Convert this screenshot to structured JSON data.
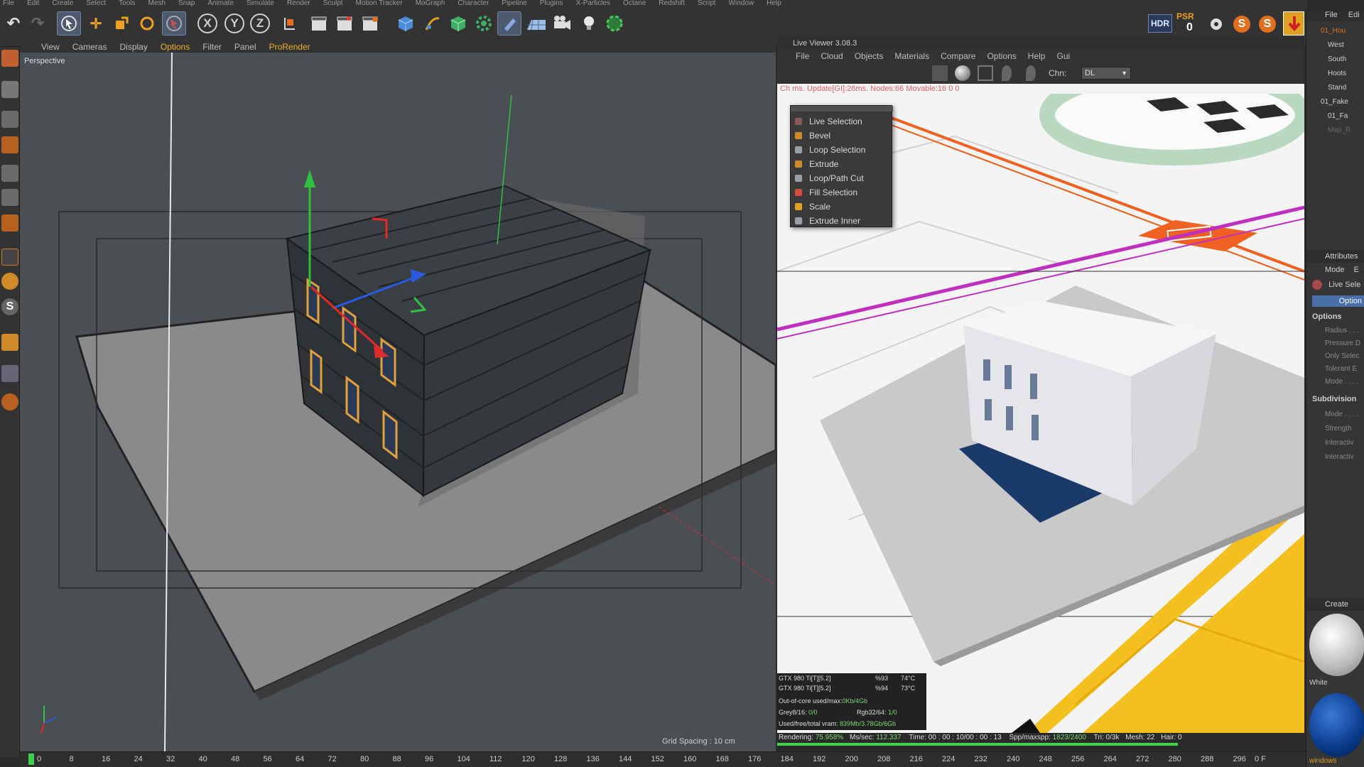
{
  "menubar": [
    "File",
    "Edit",
    "Create",
    "Select",
    "Tools",
    "Mesh",
    "Snap",
    "Animate",
    "Simulate",
    "Render",
    "Sculpt",
    "Motion Tracker",
    "MoGraph",
    "Character",
    "Pipeline",
    "Plugins",
    "X-Particles",
    "Octane",
    "Redshift",
    "Script",
    "Window",
    "Help"
  ],
  "toolbar": {
    "axis_x": "X",
    "axis_y": "Y",
    "axis_z": "Z",
    "hdr": "HDR",
    "psr_label": "PSR",
    "psr_value": "0"
  },
  "viewport": {
    "menu": [
      "View",
      "Cameras",
      "Display",
      "Options",
      "Filter",
      "Panel",
      "ProRender"
    ],
    "label": "Perspective",
    "grid_spacing": "Grid Spacing : 10 cm",
    "colors": {
      "bg": "#4b4e52",
      "ground": "#8a8a8a",
      "building": "#2f3236"
    }
  },
  "live_viewer": {
    "title": "Live Viewer 3.08.3",
    "menu": [
      "File",
      "Cloud",
      "Objects",
      "Materials",
      "Compare",
      "Options",
      "Help",
      "Gui"
    ],
    "chn_label": "Chn:",
    "chn_value": "DL",
    "status": "Ch                    ms. Update[GI]:26ms. Nodes:66 Movable:16  0 0",
    "footer": {
      "rendering_label": "Rendering:",
      "rendering_value": "75.958%",
      "ms_label": "Ms/sec:",
      "ms_value": "112.337",
      "time": "Time: 00 : 00 : 10/00 : 00 : 13",
      "spp_label": "Spp/maxspp:",
      "spp_value": "1823/2400",
      "tri": "Tri: 0/3k",
      "mesh": "Mesh: 22",
      "hair": "Hair: 0",
      "progress": 75.958
    }
  },
  "context_menu": {
    "items": [
      {
        "label": "Live Selection",
        "icon": "live-selection-icon",
        "color": "#8a5a5a"
      },
      {
        "label": "Bevel",
        "icon": "bevel-icon",
        "color": "#d08a2a"
      },
      {
        "label": "Loop Selection",
        "icon": "loop-selection-icon",
        "color": "#9aa0a8"
      },
      {
        "label": "Extrude",
        "icon": "extrude-icon",
        "color": "#d08a2a"
      },
      {
        "label": "Loop/Path Cut",
        "icon": "loop-path-cut-icon",
        "color": "#9aa0a8"
      },
      {
        "label": "Fill Selection",
        "icon": "fill-selection-icon",
        "color": "#d84a3a"
      },
      {
        "label": "Scale",
        "icon": "scale-icon",
        "color": "#e0a020"
      },
      {
        "label": "Extrude Inner",
        "icon": "extrude-inner-icon",
        "color": "#9aa0a8"
      }
    ]
  },
  "gpu": {
    "rows": [
      {
        "name": "GTX 980 Ti[T][5.2]",
        "pct": "%93",
        "temp": "74°C"
      },
      {
        "name": "GTX 980 Ti[T][5.2]",
        "pct": "%94",
        "temp": "73°C"
      }
    ],
    "outofcore_label": "Out-of-core used/max:",
    "outofcore_value": "0Kb/4Gb",
    "grey_label": "Grey8/16:",
    "grey_value": "0/0",
    "rgb_label": "Rgb32/64:",
    "rgb_value": "1/0",
    "vram_label": "Used/free/total vram:",
    "vram_value": "839Mb/3.78Gb/6Gb"
  },
  "timeline": {
    "ticks": [
      "0",
      "8",
      "16",
      "24",
      "32",
      "40",
      "48",
      "56",
      "64",
      "72",
      "80",
      "88",
      "96",
      "104",
      "112",
      "120",
      "128",
      "136",
      "144",
      "152",
      "160",
      "168",
      "176",
      "184",
      "192",
      "200",
      "208",
      "216",
      "224",
      "232",
      "240",
      "248",
      "256",
      "264",
      "272",
      "280",
      "288",
      "296"
    ],
    "frame": "0 F"
  },
  "right_panel": {
    "file_menu": "File",
    "edit_menu": "Edi",
    "tree": [
      "01_Hou",
      "West",
      "South",
      "Hoots",
      "Stand",
      "01_Fake",
      "01_Fa",
      "Map_R"
    ],
    "attributes": "Attributes",
    "mode": "Mode",
    "mode_edit": "E",
    "live_sel": "Live Sele",
    "options_tab": "Option",
    "options_title": "Options",
    "options": [
      "Radius . . .",
      "Pressure D",
      "Only Selec",
      "Tolerant E",
      "Mode . . . ."
    ],
    "subdivision_title": "Subdivision",
    "subdivision": [
      "Mode . . . .",
      "Strength",
      "Interactiv",
      "Interactiv"
    ],
    "create": "Create",
    "mat1": "White",
    "mat2": "windows"
  }
}
